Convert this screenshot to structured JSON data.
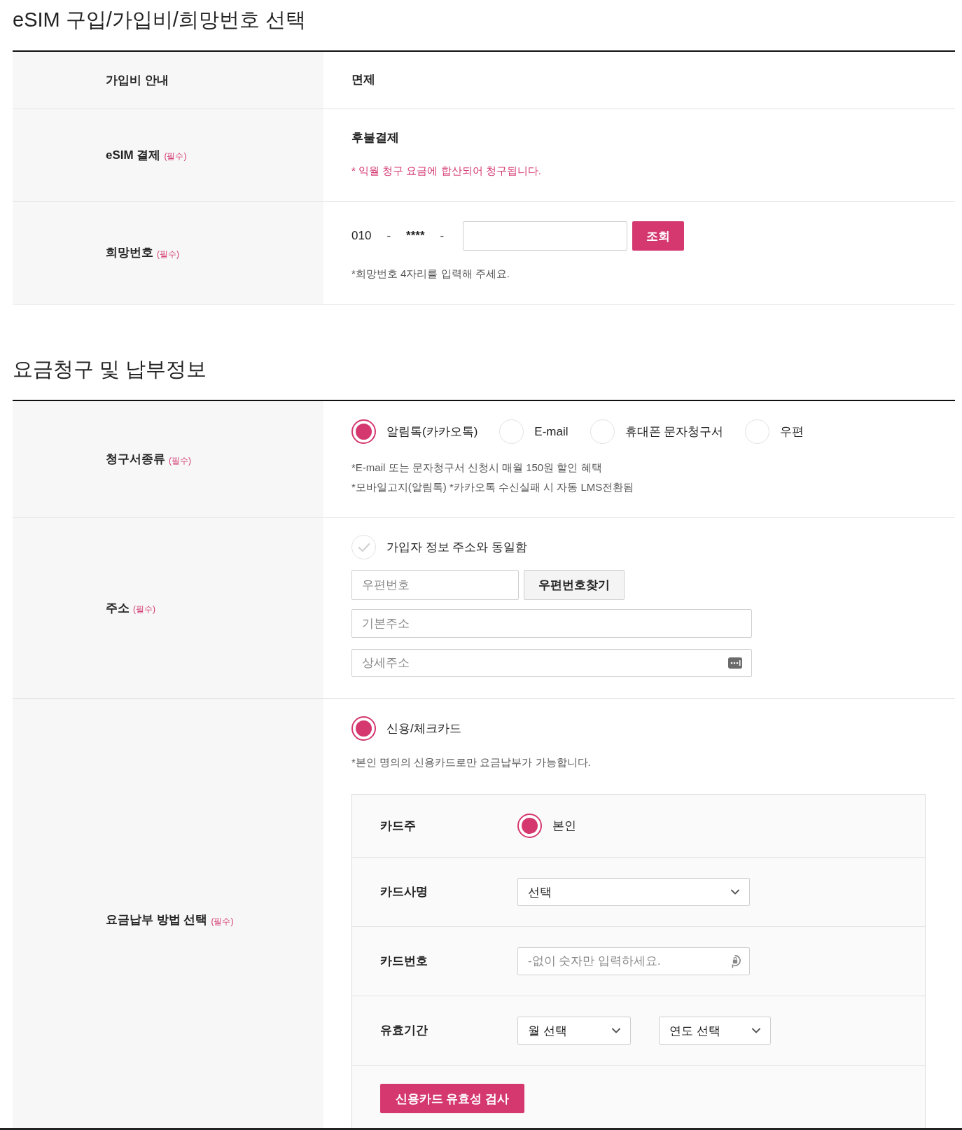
{
  "sections": [
    {
      "title": "eSIM 구입/가입비/희망번호 선택",
      "rows": [
        {
          "kind": "plain",
          "label": "가입비 안내",
          "value": "면제"
        },
        {
          "kind": "plain",
          "label": "eSIM 결제",
          "required_mark": "(필수)",
          "value": "후불결제",
          "note": "* 익월 청구 요금에 합산되어 청구됩니다."
        },
        {
          "kind": "phone",
          "label": "희망번호",
          "required_mark": "(필수)",
          "number_parts": [
            {
              "kind": "prefix",
              "text": "010"
            },
            {
              "kind": "separator",
              "text": "-"
            },
            {
              "kind": "masked",
              "text": "****"
            },
            {
              "kind": "separator",
              "text": "-"
            }
          ],
          "lookup_button": "조회",
          "hint": "*희망번호 4자리를 입력해 주세요."
        }
      ]
    },
    {
      "title": "요금청구 및 납부정보",
      "rows": [
        {
          "kind": "radio_group",
          "label": "청구서종류",
          "required_mark": "(필수)",
          "options": [
            {
              "label": "알림톡(카카오톡)",
              "selected": true
            },
            {
              "label": "E-mail",
              "selected": false
            },
            {
              "label": "휴대폰 문자청구서",
              "selected": false
            },
            {
              "label": "우편",
              "selected": false
            }
          ],
          "notes": [
            "*E-mail 또는 문자청구서 신청시 매월 150원 할인 혜택",
            "*모바일고지(알림톡) *카카오톡 수신실패 시 자동 LMS전환됨"
          ]
        },
        {
          "kind": "address",
          "label": "주소",
          "required_mark": "(필수)",
          "same_as_subscriber": {
            "label": "가입자 정보 주소와 동일함",
            "checked": false
          },
          "zip": {
            "placeholder": "우편번호"
          },
          "zip_button": "우편번호찾기",
          "base_address": {
            "placeholder": "기본주소"
          },
          "detail_address": {
            "placeholder": "상세주소"
          }
        },
        {
          "kind": "payment_method",
          "label": "요금납부 방법 선택",
          "required_mark": "(필수)",
          "methods": [
            {
              "label": "신용/체크카드",
              "selected": true
            }
          ],
          "note": "*본인 명의의 신용카드로만 요금납부가 가능합니다.",
          "card_form": {
            "rows": [
              {
                "kind": "radio",
                "label": "카드주",
                "options": [
                  {
                    "label": "본인",
                    "selected": true
                  }
                ]
              },
              {
                "kind": "select",
                "label": "카드사명",
                "selects": [
                  {
                    "value": "선택"
                  }
                ]
              },
              {
                "kind": "input",
                "label": "카드번호",
                "placeholder": "-없이 숫자만 입력하세요."
              },
              {
                "kind": "select",
                "label": "유효기간",
                "selects": [
                  {
                    "value": "월 선택"
                  },
                  {
                    "value": "연도 선택"
                  }
                ]
              },
              {
                "kind": "button",
                "button": "신용카드 유효성 검사"
              }
            ]
          }
        }
      ]
    }
  ]
}
